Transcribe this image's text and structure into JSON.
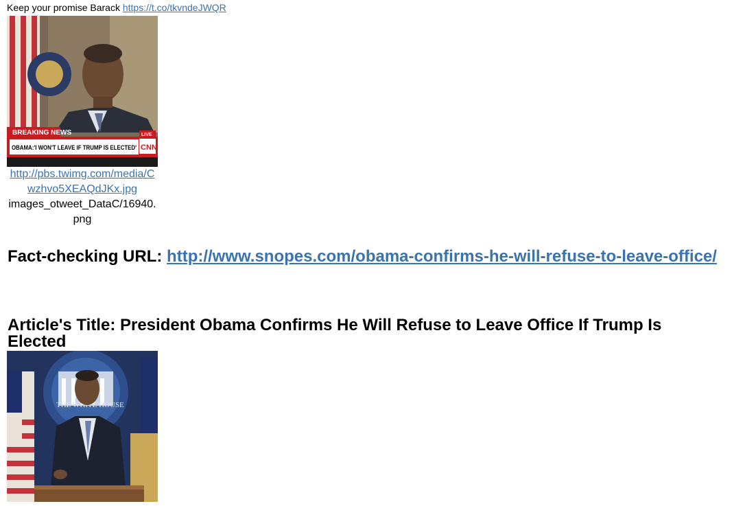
{
  "tweet": {
    "text": "Keep your promise Barack",
    "link": "https://t.co/tkvndeJWQR"
  },
  "media": {
    "image_url": "http://pbs.twimg.com/media/Cwzhvo5XEAQdJKx.jpg",
    "image_path": "images_otweet_DataC/16940.png",
    "banner_label": "BREAKING NEWS",
    "headline": "OBAMA:'I WON'T LEAVE IF TRUMP IS ELECTED'",
    "live_label": "LIVE",
    "network": "CNN"
  },
  "fact_check": {
    "label": "Fact-checking URL:",
    "url": "http://www.snopes.com/obama-confirms-he-will-refuse-to-leave-office/"
  },
  "article": {
    "title": "Article's Title: President Obama Confirms He Will Refuse to Leave Office If Trump Is Elected",
    "seal_text": "THE WHITE HOUSE"
  }
}
